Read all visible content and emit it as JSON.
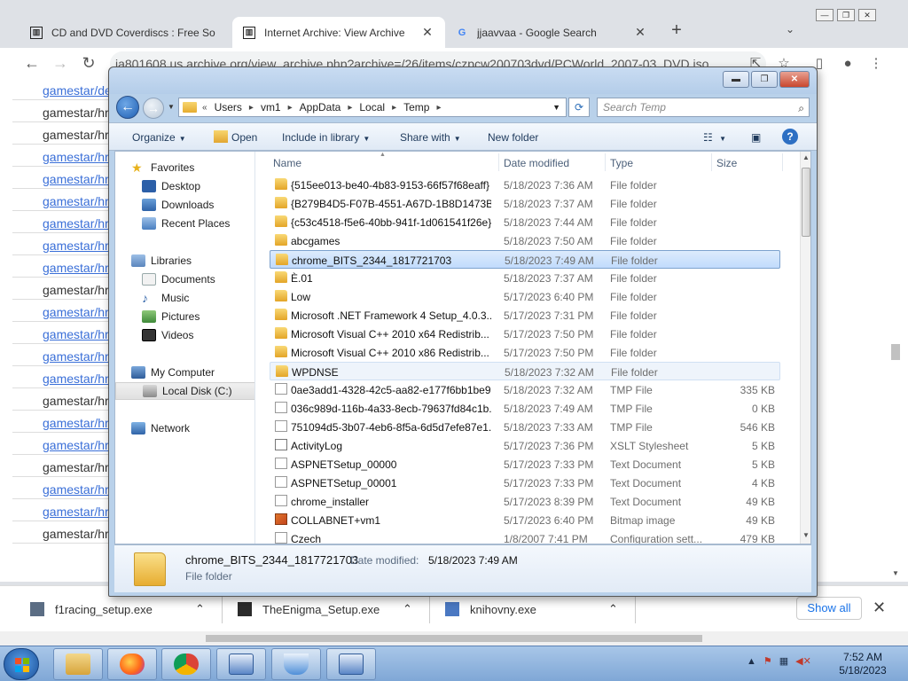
{
  "browser": {
    "tabs": [
      {
        "title": "CD and DVD Coverdiscs : Free So",
        "favicon": "internet-archive-icon"
      },
      {
        "title": "Internet Archive: View Archive",
        "favicon": "internet-archive-icon"
      },
      {
        "title": "jjaavvaa - Google Search",
        "favicon": "google-icon"
      }
    ],
    "new_tab": "+",
    "url": "ia801608.us.archive.org/view_archive.php?archive=/26/items/czpcw200703dvd/PCWorld_2007-03_DVD.iso",
    "page_lines": [
      {
        "text": "gamestar/de",
        "style": "link"
      },
      {
        "text": "gamestar/hr",
        "style": "dark"
      },
      {
        "text": "gamestar/hr",
        "style": "dark"
      },
      {
        "text": "gamestar/hr",
        "style": "link"
      },
      {
        "text": "gamestar/hr",
        "style": "link"
      },
      {
        "text": "gamestar/hr",
        "style": "link"
      },
      {
        "text": "gamestar/hr",
        "style": "link"
      },
      {
        "text": "gamestar/hr",
        "style": "link"
      },
      {
        "text": "gamestar/hr",
        "style": "link"
      },
      {
        "text": "gamestar/hr",
        "style": "dark"
      },
      {
        "text": "gamestar/hr",
        "style": "link"
      },
      {
        "text": "gamestar/hr",
        "style": "link"
      },
      {
        "text": "gamestar/hr",
        "style": "link"
      },
      {
        "text": "gamestar/hr",
        "style": "link"
      },
      {
        "text": "gamestar/hr",
        "style": "dark"
      },
      {
        "text": "gamestar/hr",
        "style": "link"
      },
      {
        "text": "gamestar/hr",
        "style": "link"
      },
      {
        "text": "gamestar/hr",
        "style": "dark"
      },
      {
        "text": "gamestar/hr",
        "style": "link"
      },
      {
        "text": "gamestar/hr",
        "style": "link"
      },
      {
        "text": "gamestar/hr",
        "style": "dark"
      }
    ],
    "downloads": [
      {
        "name": "f1racing_setup.exe"
      },
      {
        "name": "TheEnigma_Setup.exe"
      },
      {
        "name": "knihovny.exe"
      }
    ],
    "show_all": "Show all"
  },
  "explorer": {
    "breadcrumb": [
      "Users",
      "vm1",
      "AppData",
      "Local",
      "Temp"
    ],
    "search_placeholder": "Search Temp",
    "commands": {
      "organize": "Organize",
      "open": "Open",
      "include": "Include in library",
      "share": "Share with",
      "new_folder": "New folder"
    },
    "nav": {
      "favorites": "Favorites",
      "desktop": "Desktop",
      "downloads": "Downloads",
      "recent": "Recent Places",
      "libraries": "Libraries",
      "documents": "Documents",
      "music": "Music",
      "pictures": "Pictures",
      "videos": "Videos",
      "computer": "My Computer",
      "localdisk": "Local Disk (C:)",
      "network": "Network"
    },
    "columns": {
      "name": "Name",
      "date": "Date modified",
      "type": "Type",
      "size": "Size"
    },
    "files": [
      {
        "name": "{515ee013-be40-4b83-9153-66f57f68eaff}",
        "date": "5/18/2023 7:36 AM",
        "type": "File folder",
        "size": "",
        "icon": "folder"
      },
      {
        "name": "{B279B4D5-F07B-4551-A67D-1B8D1473B...",
        "date": "5/18/2023 7:37 AM",
        "type": "File folder",
        "size": "",
        "icon": "folder"
      },
      {
        "name": "{c53c4518-f5e6-40bb-941f-1d061541f26e}",
        "date": "5/18/2023 7:44 AM",
        "type": "File folder",
        "size": "",
        "icon": "folder"
      },
      {
        "name": "abcgames",
        "date": "5/18/2023 7:50 AM",
        "type": "File folder",
        "size": "",
        "icon": "folder"
      },
      {
        "name": "chrome_BITS_2344_1817721703",
        "date": "5/18/2023 7:49 AM",
        "type": "File folder",
        "size": "",
        "icon": "folder",
        "state": "selected"
      },
      {
        "name": "È.01",
        "date": "5/18/2023 7:37 AM",
        "type": "File folder",
        "size": "",
        "icon": "folder"
      },
      {
        "name": "Low",
        "date": "5/17/2023 6:40 PM",
        "type": "File folder",
        "size": "",
        "icon": "folder"
      },
      {
        "name": "Microsoft .NET Framework 4 Setup_4.0.3...",
        "date": "5/17/2023 7:31 PM",
        "type": "File folder",
        "size": "",
        "icon": "folder"
      },
      {
        "name": "Microsoft Visual C++ 2010  x64 Redistrib...",
        "date": "5/17/2023 7:50 PM",
        "type": "File folder",
        "size": "",
        "icon": "folder"
      },
      {
        "name": "Microsoft Visual C++ 2010  x86 Redistrib...",
        "date": "5/17/2023 7:50 PM",
        "type": "File folder",
        "size": "",
        "icon": "folder"
      },
      {
        "name": "WPDNSE",
        "date": "5/18/2023 7:32 AM",
        "type": "File folder",
        "size": "",
        "icon": "folder",
        "state": "hover"
      },
      {
        "name": "0ae3add1-4328-42c5-aa82-e177f6bb1be9...",
        "date": "5/18/2023 7:32 AM",
        "type": "TMP File",
        "size": "335 KB",
        "icon": "file"
      },
      {
        "name": "036c989d-116b-4a33-8ecb-79637fd84c1b...",
        "date": "5/18/2023 7:49 AM",
        "type": "TMP File",
        "size": "0 KB",
        "icon": "file"
      },
      {
        "name": "751094d5-3b07-4eb6-8f5a-6d5d7efe87e1...",
        "date": "5/18/2023 7:33 AM",
        "type": "TMP File",
        "size": "546 KB",
        "icon": "file"
      },
      {
        "name": "ActivityLog",
        "date": "5/17/2023 7:36 PM",
        "type": "XSLT Stylesheet",
        "size": "5 KB",
        "icon": "xslt"
      },
      {
        "name": "ASPNETSetup_00000",
        "date": "5/17/2023 7:33 PM",
        "type": "Text Document",
        "size": "5 KB",
        "icon": "file"
      },
      {
        "name": "ASPNETSetup_00001",
        "date": "5/17/2023 7:33 PM",
        "type": "Text Document",
        "size": "4 KB",
        "icon": "file"
      },
      {
        "name": "chrome_installer",
        "date": "5/17/2023 8:39 PM",
        "type": "Text Document",
        "size": "49 KB",
        "icon": "file"
      },
      {
        "name": "COLLABNET+vm1",
        "date": "5/17/2023 6:40 PM",
        "type": "Bitmap image",
        "size": "49 KB",
        "icon": "bmp"
      },
      {
        "name": "Czech",
        "date": "1/8/2007 7:41 PM",
        "type": "Configuration sett...",
        "size": "479 KB",
        "icon": "file"
      }
    ],
    "details": {
      "name": "chrome_BITS_2344_1817721703",
      "modified_label": "Date modified:",
      "modified_value": "5/18/2023 7:49 AM",
      "type": "File folder"
    }
  },
  "taskbar": {
    "apps": [
      "file-explorer",
      "firefox",
      "chrome",
      "window-app",
      "installer-app",
      "window-app-2"
    ],
    "time": "7:52 AM",
    "date": "5/18/2023"
  }
}
